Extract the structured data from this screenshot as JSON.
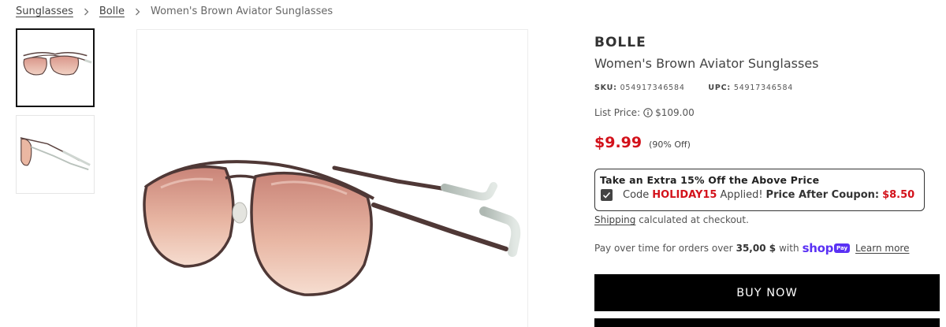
{
  "breadcrumb": {
    "items": [
      {
        "label": "Sunglasses"
      },
      {
        "label": "Bolle"
      }
    ],
    "current": "Women's Brown Aviator Sunglasses"
  },
  "gallery": {
    "thumbnails": [
      {
        "view": "front",
        "selected": true
      },
      {
        "view": "side",
        "selected": false
      }
    ]
  },
  "product": {
    "brand": "BOLLE",
    "title": "Women's Brown Aviator Sunglasses",
    "sku_label": "SKU:",
    "sku": "054917346584",
    "upc_label": "UPC:",
    "upc": "54917346584",
    "list_price_label": "List Price:",
    "list_price": "$109.00",
    "sale_price": "$9.99",
    "discount": "(90% Off)"
  },
  "coupon": {
    "title": "Take an Extra 15% Off the Above Price",
    "checked": true,
    "code_prefix": "Code",
    "code": "HOLIDAY15",
    "applied_text": "Applied!",
    "after_label": "Price After Coupon:",
    "after_price": "$8.50"
  },
  "shipping": {
    "link": "Shipping",
    "text": "calculated at checkout."
  },
  "installments": {
    "prefix": "Pay over time for orders over",
    "threshold": "35,00 $",
    "with_text": "with",
    "shop_word": "shop",
    "pay_badge": "Pay",
    "learn_more": "Learn more"
  },
  "actions": {
    "buy_now": "BUY NOW"
  },
  "colors": {
    "sale_red": "#d3121b",
    "shop_purple": "#5a31f4",
    "button_black": "#000000",
    "lens_tint": "#e8b29c",
    "frame_brown": "#5b4340"
  }
}
